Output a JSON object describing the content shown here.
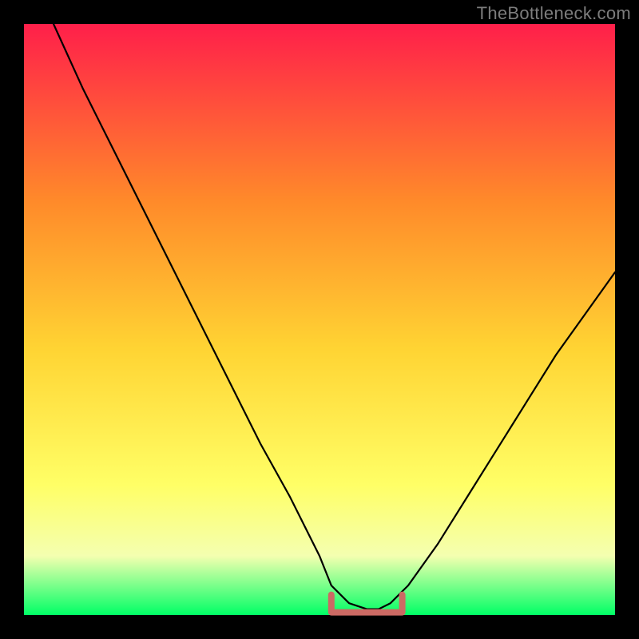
{
  "watermark": "TheBottleneck.com",
  "colors": {
    "frame": "#000000",
    "gradient_top": "#ff1f4a",
    "gradient_mid1": "#ff8a2a",
    "gradient_mid2": "#ffd433",
    "gradient_mid3": "#ffff66",
    "gradient_mid4": "#f4ffb0",
    "gradient_bottom": "#00ff66",
    "curve": "#000000",
    "brace": "#cc6a64"
  },
  "chart_data": {
    "type": "line",
    "title": "",
    "xlabel": "",
    "ylabel": "",
    "xlim": [
      0,
      100
    ],
    "ylim": [
      0,
      100
    ],
    "legend": false,
    "grid": false,
    "series": [
      {
        "name": "bottleneck-curve",
        "x": [
          5,
          10,
          15,
          20,
          25,
          30,
          35,
          40,
          45,
          50,
          52,
          55,
          58,
          60,
          62,
          65,
          70,
          75,
          80,
          85,
          90,
          95,
          100
        ],
        "y": [
          100,
          89,
          79,
          69,
          59,
          49,
          39,
          29,
          20,
          10,
          5,
          2,
          1,
          1,
          2,
          5,
          12,
          20,
          28,
          36,
          44,
          51,
          58
        ]
      }
    ],
    "annotations": [
      {
        "name": "min-bracket",
        "x_from": 52,
        "x_to": 64,
        "y": 1
      }
    ]
  }
}
